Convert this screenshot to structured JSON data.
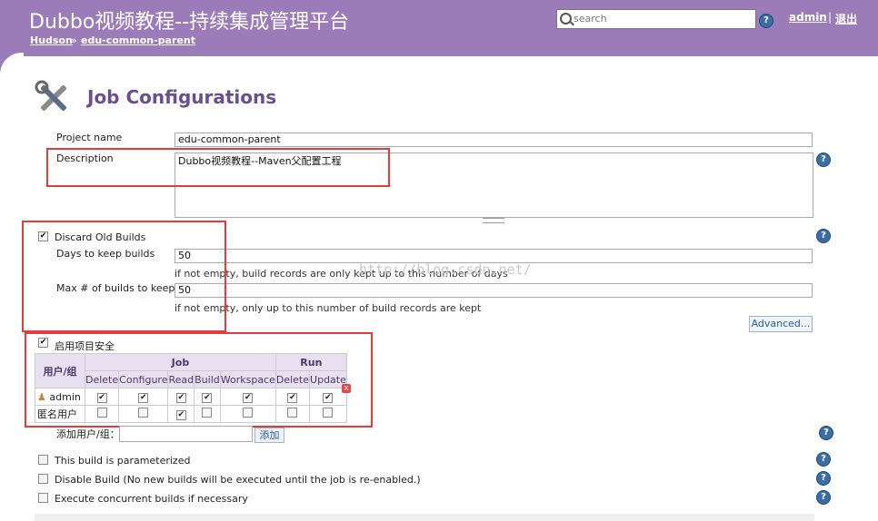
{
  "header": {
    "title": "Dubbo视频教程--持续集成管理平台",
    "breadcrumb": [
      "Hudson",
      "edu-common-parent"
    ],
    "breadcrumb_sep": "»",
    "search_placeholder": "search",
    "user_link": "admin",
    "logout_link": "退出",
    "colors": {
      "bar": "#9c7bb9",
      "title_accent": "#6a4e8f",
      "link": "#2a5aa0"
    }
  },
  "main": {
    "page_title": "Job Configurations",
    "project_name": {
      "label": "Project name",
      "value": "edu-common-parent"
    },
    "description": {
      "label": "Description",
      "value": "Dubbo视频教程--Maven父配置工程"
    },
    "discard_old_builds": {
      "label": "Discard Old Builds",
      "checked": true,
      "days_label": "Days to keep builds",
      "days_value": "50",
      "days_note": "if not empty, build records are only kept up to this number of days",
      "max_label": "Max # of builds to keep",
      "max_value": "50",
      "max_note": "if not empty, only up to this number of build records are kept"
    },
    "advanced_button": "Advanced...",
    "security": {
      "enable_label": "启用项目安全",
      "checked": true,
      "user_group_header": "用户/组",
      "groups": [
        {
          "name": "Job",
          "cols": [
            "Delete",
            "Configure",
            "Read",
            "Build",
            "Workspace"
          ]
        },
        {
          "name": "Run",
          "cols": [
            "Delete",
            "Update"
          ]
        }
      ],
      "rows": [
        {
          "user": "admin",
          "perms": [
            "✔",
            "✔",
            "✔",
            "✔",
            "✔",
            "✔",
            "✔"
          ]
        },
        {
          "user": "匿名用户",
          "perms": [
            "",
            "",
            "✔",
            "",
            "",
            "",
            ""
          ]
        }
      ],
      "add_user_label": "添加用户/组：",
      "add_button": "添加"
    },
    "options": [
      {
        "label": "This build is parameterized",
        "checked": false
      },
      {
        "label": "Disable Build (No new builds will be executed until the job is re-enabled.)",
        "checked": false
      },
      {
        "label": "Execute concurrent builds if necessary",
        "checked": false
      }
    ],
    "help_glyph": "?",
    "remove_glyph": "x",
    "watermark": "http://blog.csdn.net/"
  }
}
